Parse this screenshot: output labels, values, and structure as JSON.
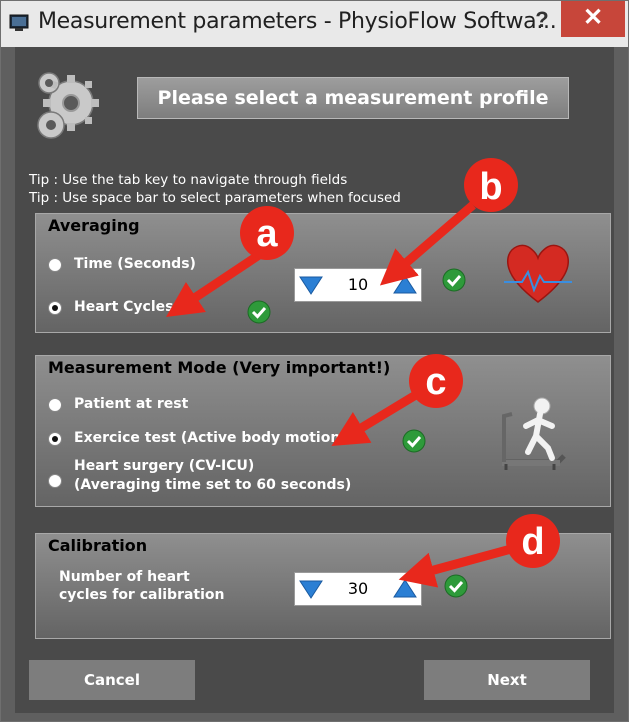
{
  "window": {
    "title": "Measurement parameters - PhysioFlow Softwa...",
    "help_label": "?",
    "close_label": "✕"
  },
  "header": {
    "profile_button_label": "Please select a measurement profile"
  },
  "tips": [
    "Tip : Use the tab key to navigate through fields",
    "Tip : Use space bar to select parameters when focused"
  ],
  "averaging": {
    "title": "Averaging",
    "options": [
      {
        "label": "Time (Seconds)",
        "selected": false
      },
      {
        "label": "Heart Cycles",
        "selected": true
      }
    ],
    "value": "10"
  },
  "mode": {
    "title": "Measurement Mode (Very important!)",
    "options": [
      {
        "label": "Patient at rest",
        "selected": false
      },
      {
        "label": "Exercice test (Active body motion)",
        "selected": true
      },
      {
        "label": "Heart surgery (CV-ICU)",
        "sub": "(Averaging time set to 60 seconds)",
        "selected": false
      }
    ]
  },
  "calibration": {
    "title": "Calibration",
    "label_line1": "Number of heart",
    "label_line2": "cycles for calibration",
    "value": "30"
  },
  "footer": {
    "cancel_label": "Cancel",
    "next_label": "Next"
  },
  "annotations": [
    "a",
    "b",
    "c",
    "d"
  ],
  "colors": {
    "annotation_red": "#e8281c",
    "spin_blue": "#2b7fd4",
    "check_green": "#2e9a3a"
  }
}
